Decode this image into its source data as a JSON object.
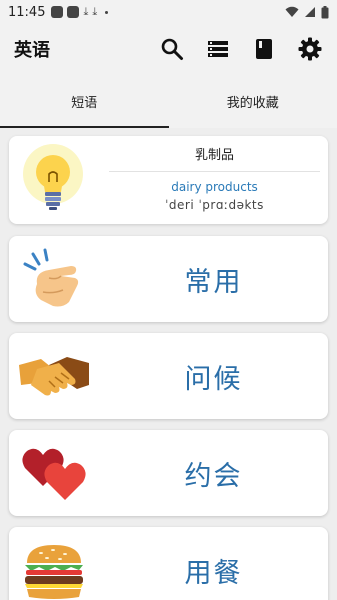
{
  "status_bar": {
    "time": "11:45"
  },
  "app_bar": {
    "title": "英语",
    "actions": [
      "search-icon",
      "list-icon",
      "book-icon",
      "gear-icon"
    ]
  },
  "tabs": [
    {
      "label": "短语",
      "active": true
    },
    {
      "label": "我的收藏",
      "active": false
    }
  ],
  "word_card": {
    "word": "乳制品",
    "translation": "dairy products",
    "phonetic": "ˈderi ˈprɑːdəkts",
    "icon": "lightbulb-icon"
  },
  "categories": [
    {
      "label": "常用",
      "icon": "finger-snap-icon"
    },
    {
      "label": "问候",
      "icon": "handshake-icon"
    },
    {
      "label": "约会",
      "icon": "hearts-icon"
    },
    {
      "label": "用餐",
      "icon": "burger-icon"
    }
  ],
  "colors": {
    "background": "#eeeeee",
    "accent_text": "#2a6ea8",
    "translation_text": "#2a7ab8",
    "card": "#ffffff"
  }
}
